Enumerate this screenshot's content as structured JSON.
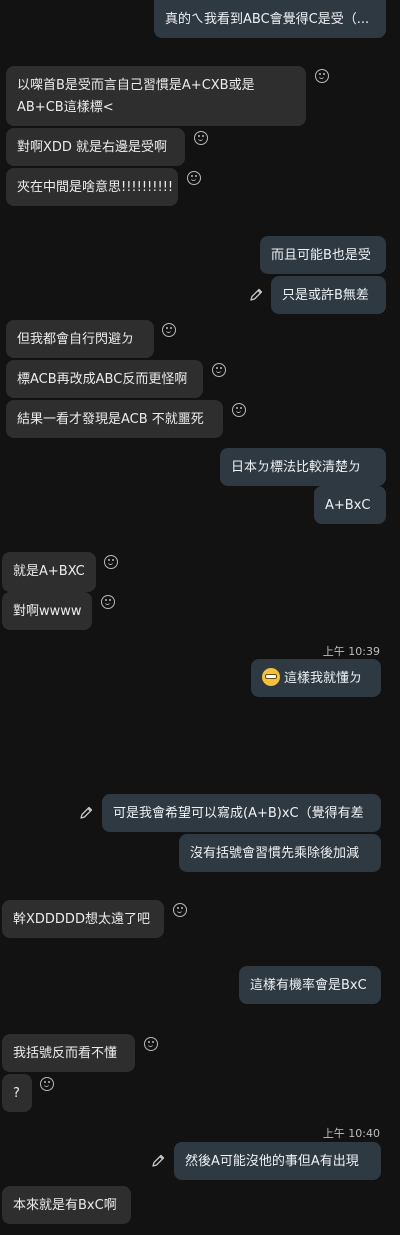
{
  "messages": [
    {
      "side": "out",
      "text": "真的ㄟ我看到ABC會覺得C是受（..."
    },
    {
      "side": "in",
      "text": "以㗎首B是受而言自己習慣是A+CXB或是AB+CB這樣標<"
    },
    {
      "side": "in",
      "text": "對啊XDD 就是右邊是受啊"
    },
    {
      "side": "in",
      "text": "夾在中間是啥意思!!!!!!!!!!"
    },
    {
      "side": "out",
      "text": "而且可能B也是受"
    },
    {
      "side": "out",
      "text": "只是或許B無差",
      "edited": true
    },
    {
      "side": "in",
      "text": "但我都會自行閃避ㄉ"
    },
    {
      "side": "in",
      "text": "標ACB再改成ABC反而更怪啊"
    },
    {
      "side": "in",
      "text": "結果一看才發現是ACB 不就噩死"
    },
    {
      "side": "out",
      "text": "日本ㄉ標法比較清楚ㄉ"
    },
    {
      "side": "out",
      "text": "A+BxC"
    },
    {
      "side": "in",
      "text": "就是A+BXC"
    },
    {
      "side": "in",
      "text": "對啊wwww"
    },
    {
      "side": "time",
      "text": "上午 10:39"
    },
    {
      "side": "out",
      "text": "這樣我就懂ㄉ",
      "emoji": "grinning-face"
    },
    {
      "side": "out",
      "text": "可是我會希望可以寫成(A+B)xC（覺得有差",
      "edited": true
    },
    {
      "side": "out",
      "text": "沒有括號會習慣先乘除後加減"
    },
    {
      "side": "in",
      "text": "幹XDDDDD想太遠了吧"
    },
    {
      "side": "out",
      "text": "這樣有機率會是BxC"
    },
    {
      "side": "in",
      "text": "我括號反而看不懂"
    },
    {
      "side": "in",
      "text": "?"
    },
    {
      "side": "time",
      "text": "上午 10:40"
    },
    {
      "side": "out",
      "text": "然後A可能沒他的事但A有出現",
      "edited": true
    },
    {
      "side": "in",
      "text": "本來就是有BxC啊"
    }
  ]
}
